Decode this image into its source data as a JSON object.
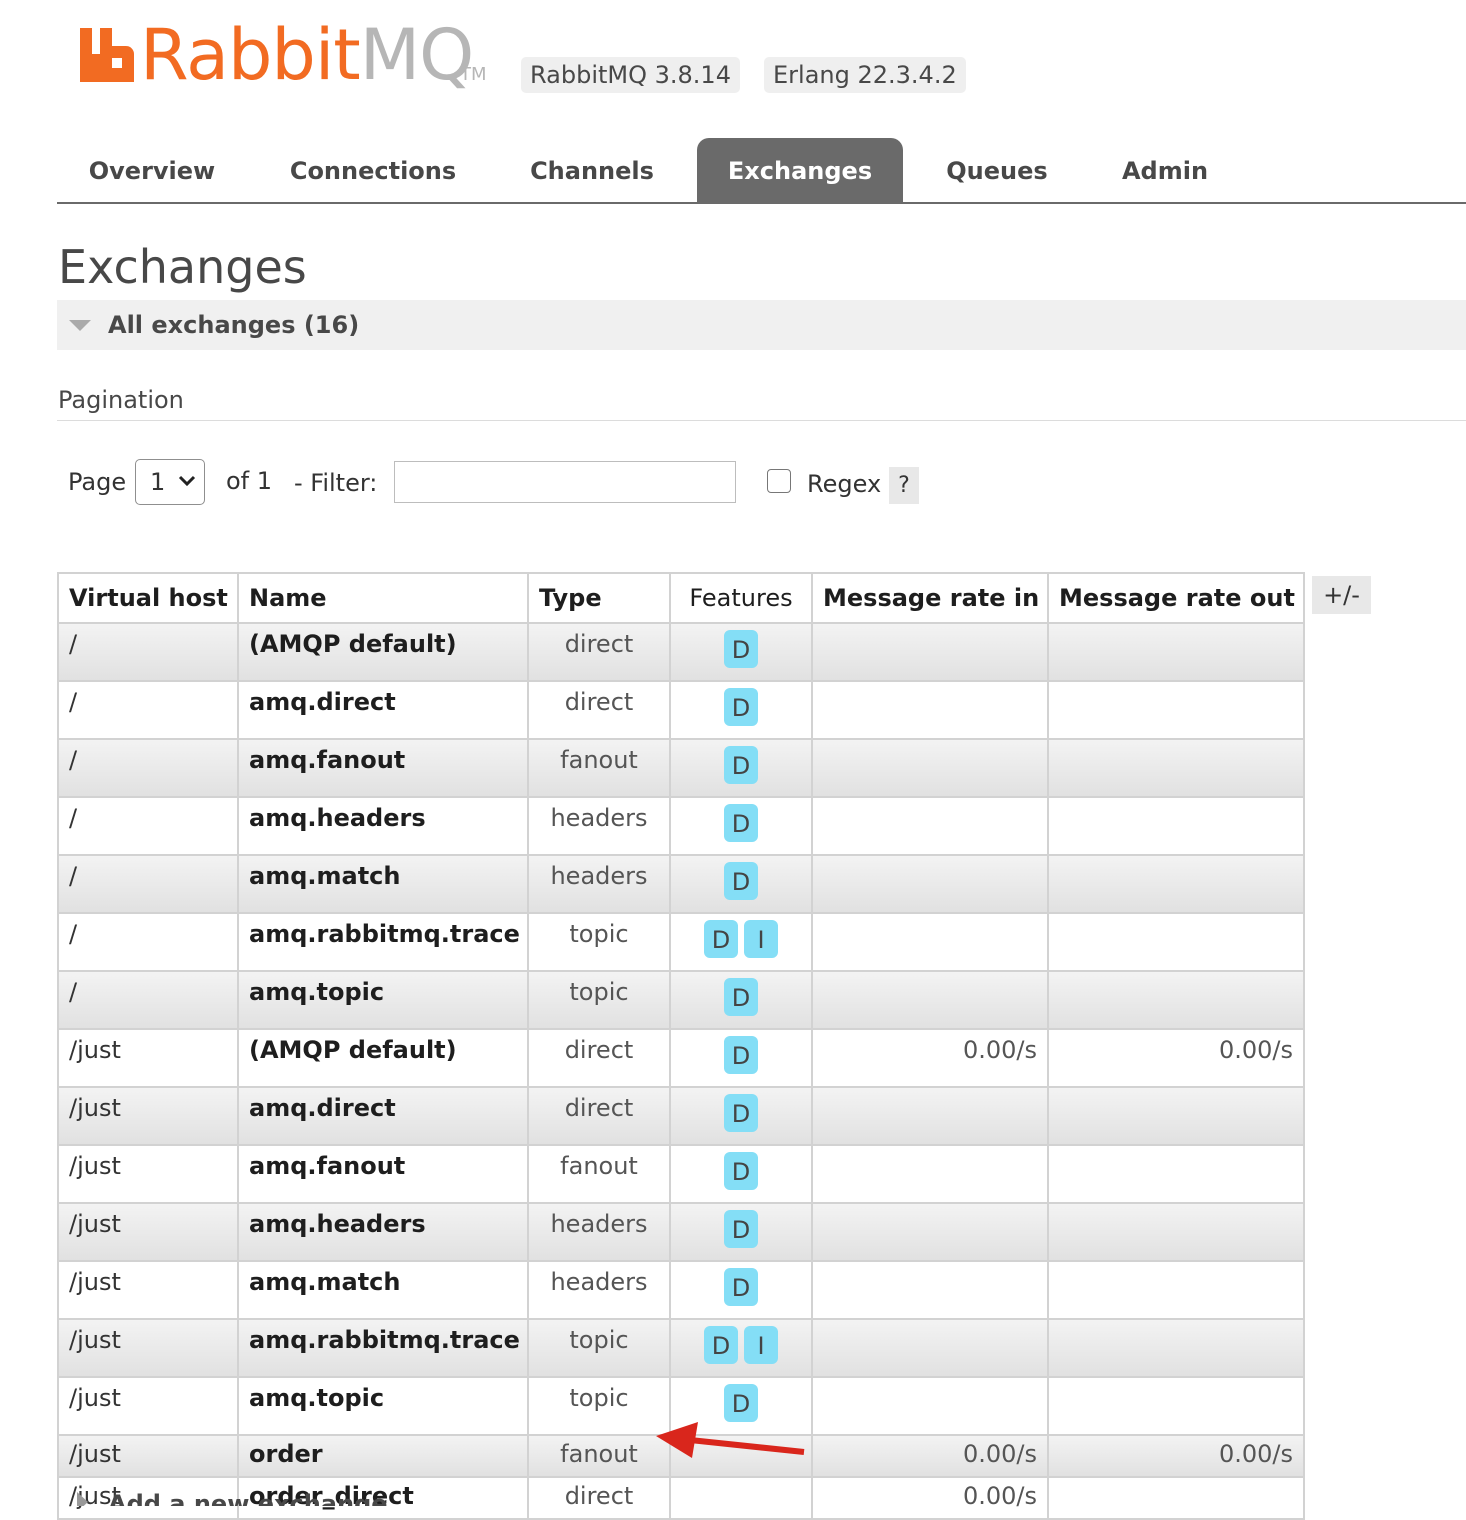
{
  "header": {
    "logo_text_rabbit": "Rabbit",
    "logo_text_mq": "MQ",
    "logo_tm": "TM",
    "rabbitmq_version": "RabbitMQ 3.8.14",
    "erlang_version": "Erlang 22.3.4.2",
    "brand_color": "#f26b22"
  },
  "nav": {
    "tabs": [
      {
        "label": "Overview"
      },
      {
        "label": "Connections"
      },
      {
        "label": "Channels"
      },
      {
        "label": "Exchanges",
        "active": true
      },
      {
        "label": "Queues"
      },
      {
        "label": "Admin"
      }
    ]
  },
  "page": {
    "title": "Exchanges",
    "section_title": "All exchanges (16)",
    "pagination_label": "Pagination"
  },
  "filter": {
    "page_label": "Page",
    "page_value": "1",
    "of_label": "of 1",
    "filter_label": "- Filter:",
    "filter_value": "",
    "regex_label": "Regex",
    "regex_checked": false,
    "help_label": "?"
  },
  "table": {
    "headers": {
      "vhost": "Virtual host",
      "name": "Name",
      "type": "Type",
      "features": "Features",
      "rate_in": "Message rate in",
      "rate_out": "Message rate out"
    },
    "toggle_columns": "+/-",
    "rows": [
      {
        "vhost": "/",
        "name": "(AMQP default)",
        "type": "direct",
        "features": [
          "D"
        ],
        "rate_in": "",
        "rate_out": ""
      },
      {
        "vhost": "/",
        "name": "amq.direct",
        "type": "direct",
        "features": [
          "D"
        ],
        "rate_in": "",
        "rate_out": ""
      },
      {
        "vhost": "/",
        "name": "amq.fanout",
        "type": "fanout",
        "features": [
          "D"
        ],
        "rate_in": "",
        "rate_out": ""
      },
      {
        "vhost": "/",
        "name": "amq.headers",
        "type": "headers",
        "features": [
          "D"
        ],
        "rate_in": "",
        "rate_out": ""
      },
      {
        "vhost": "/",
        "name": "amq.match",
        "type": "headers",
        "features": [
          "D"
        ],
        "rate_in": "",
        "rate_out": ""
      },
      {
        "vhost": "/",
        "name": "amq.rabbitmq.trace",
        "type": "topic",
        "features": [
          "D",
          "I"
        ],
        "rate_in": "",
        "rate_out": ""
      },
      {
        "vhost": "/",
        "name": "amq.topic",
        "type": "topic",
        "features": [
          "D"
        ],
        "rate_in": "",
        "rate_out": ""
      },
      {
        "vhost": "/just",
        "name": "(AMQP default)",
        "type": "direct",
        "features": [
          "D"
        ],
        "rate_in": "0.00/s",
        "rate_out": "0.00/s"
      },
      {
        "vhost": "/just",
        "name": "amq.direct",
        "type": "direct",
        "features": [
          "D"
        ],
        "rate_in": "",
        "rate_out": ""
      },
      {
        "vhost": "/just",
        "name": "amq.fanout",
        "type": "fanout",
        "features": [
          "D"
        ],
        "rate_in": "",
        "rate_out": ""
      },
      {
        "vhost": "/just",
        "name": "amq.headers",
        "type": "headers",
        "features": [
          "D"
        ],
        "rate_in": "",
        "rate_out": ""
      },
      {
        "vhost": "/just",
        "name": "amq.match",
        "type": "headers",
        "features": [
          "D"
        ],
        "rate_in": "",
        "rate_out": ""
      },
      {
        "vhost": "/just",
        "name": "amq.rabbitmq.trace",
        "type": "topic",
        "features": [
          "D",
          "I"
        ],
        "rate_in": "",
        "rate_out": ""
      },
      {
        "vhost": "/just",
        "name": "amq.topic",
        "type": "topic",
        "features": [
          "D"
        ],
        "rate_in": "",
        "rate_out": ""
      },
      {
        "vhost": "/just",
        "name": "order",
        "type": "fanout",
        "features": [],
        "rate_in": "0.00/s",
        "rate_out": "0.00/s"
      },
      {
        "vhost": "/just",
        "name": "order_direct",
        "type": "direct",
        "features": [],
        "rate_in": "0.00/s",
        "rate_out": ""
      }
    ]
  },
  "add_section": {
    "title": "Add a new exchange"
  },
  "annotation": {
    "arrow_color": "#d9261c",
    "icon": "red-arrow-icon"
  }
}
